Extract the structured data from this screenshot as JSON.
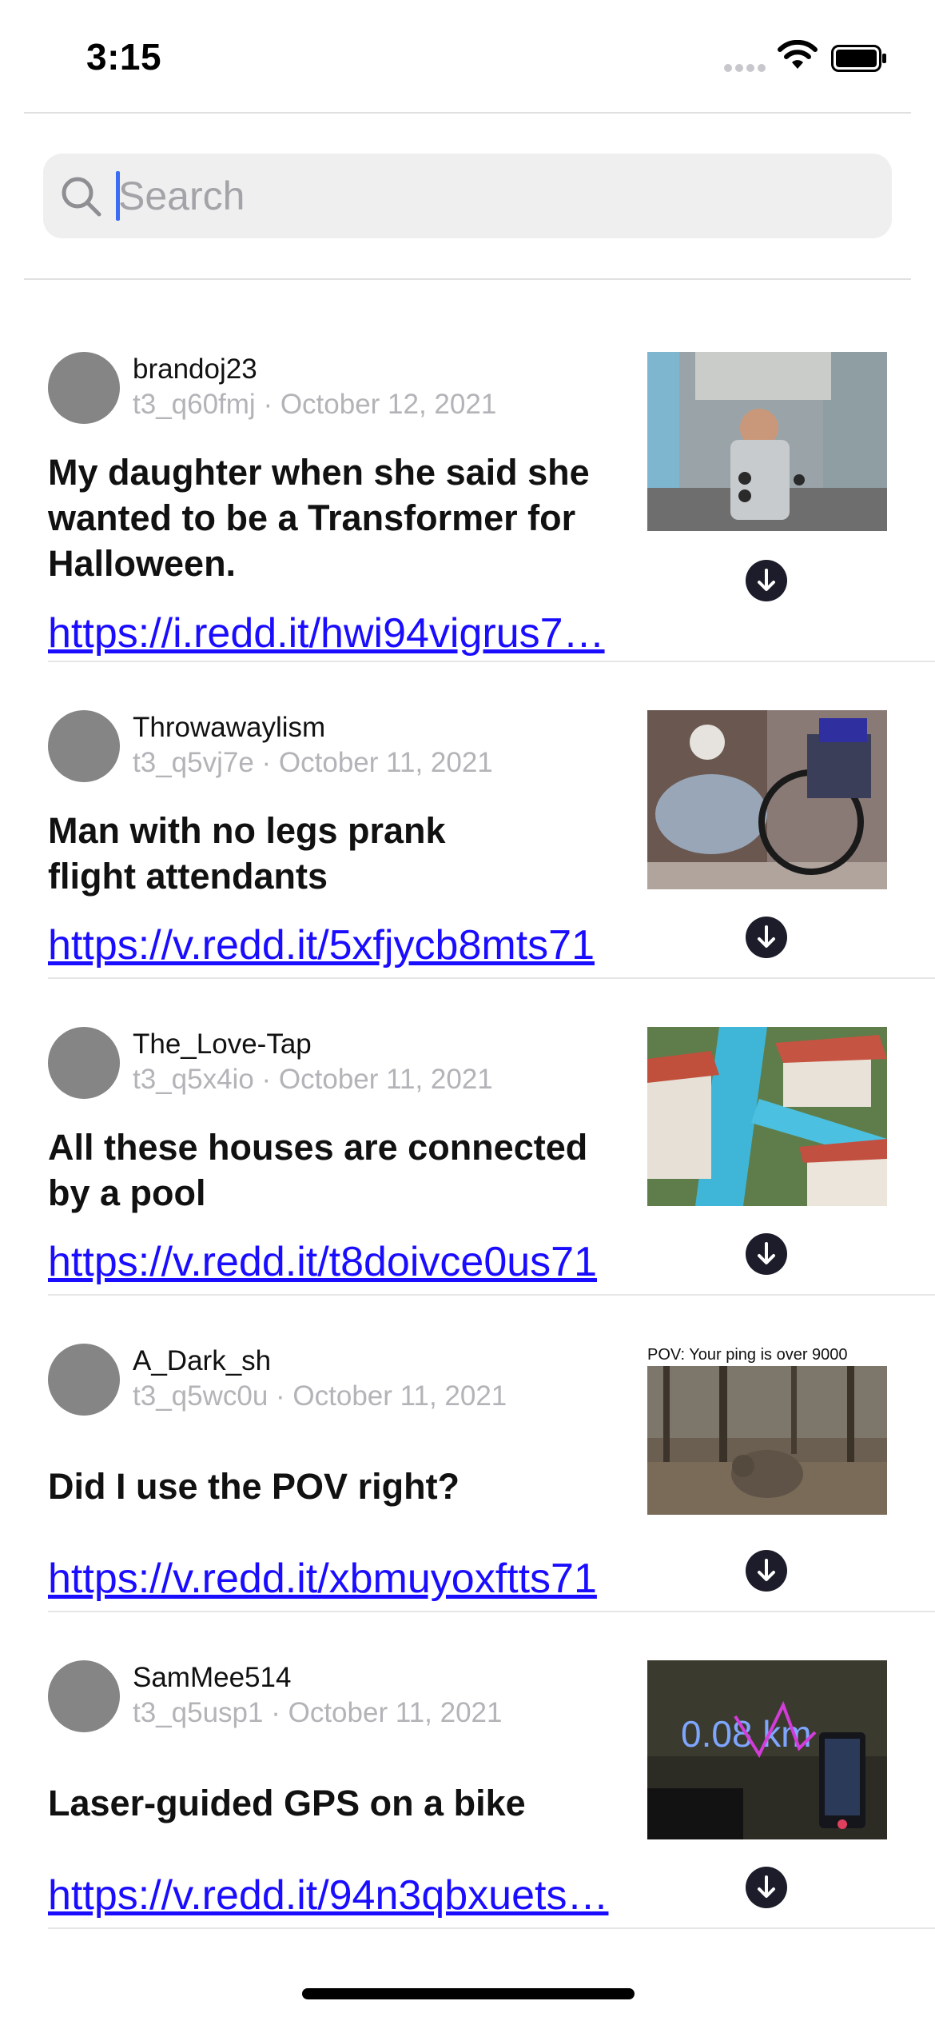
{
  "status_bar": {
    "time": "3:15"
  },
  "search": {
    "placeholder": "Search",
    "value": ""
  },
  "posts": [
    {
      "author": "brandoj23",
      "id": "t3_q60fmj",
      "date": "October 12, 2021",
      "title": "My daughter when she said she wanted to be a Transformer for Halloween.",
      "link": "https://i.redd.it/hwi94vigrus7…"
    },
    {
      "author": "Throwawaylism",
      "id": "t3_q5vj7e",
      "date": "October 11, 2021",
      "title": "Man with no legs prank flight attendants",
      "link": "https://v.redd.it/5xfjycb8mts71"
    },
    {
      "author": "The_Love-Tap",
      "id": "t3_q5x4io",
      "date": "October 11, 2021",
      "title": "All these houses are connected by a pool",
      "link": "https://v.redd.it/t8doivce0us71"
    },
    {
      "author": "A_Dark_sh",
      "id": "t3_q5wc0u",
      "date": "October 11, 2021",
      "title": "Did I use the POV right?",
      "link": "https://v.redd.it/xbmuyoxftts71",
      "thumb_caption": "POV: Your ping is over 9000"
    },
    {
      "author": "SamMee514",
      "id": "t3_q5usp1",
      "date": "October 11, 2021",
      "title": "Laser-guided GPS on a bike",
      "link": "https://v.redd.it/94n3qbxuets…",
      "thumb_caption": "0.08 km"
    }
  ],
  "icons": {
    "search": "magnifying-glass-icon",
    "download": "download-circle-icon",
    "wifi": "wifi-icon",
    "battery": "battery-icon",
    "signal": "signal-dots-icon"
  },
  "colors": {
    "link": "#1a0dff",
    "caret": "#3a6cf4",
    "avatar": "#858585"
  }
}
